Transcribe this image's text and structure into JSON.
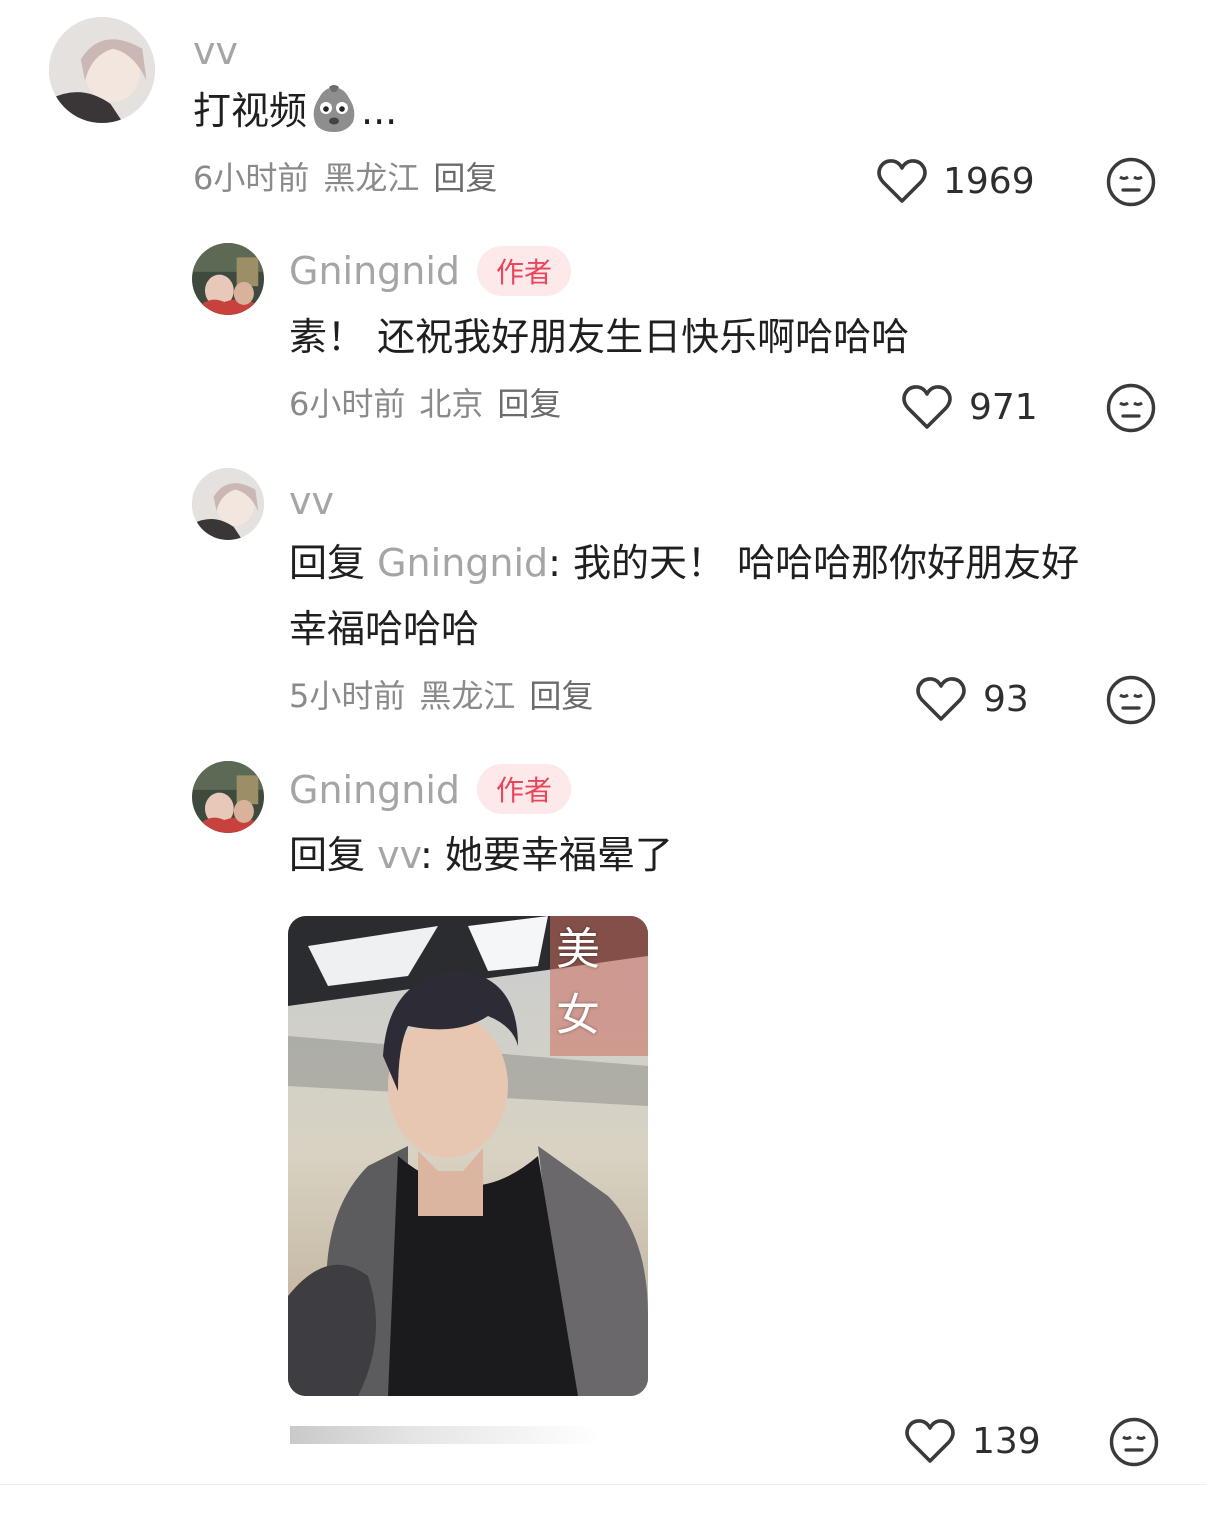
{
  "comment": {
    "author": "vv",
    "text": "打视频",
    "text_suffix": "...",
    "emoji_icon": "sad-face-emoji-icon",
    "time": "6小时前",
    "location": "黑龙江",
    "reply_label": "回复",
    "likes": "1969"
  },
  "replies": [
    {
      "author": "Gningnid",
      "badge": "作者",
      "text": "素！ 还祝我好朋友生日快乐啊哈哈哈",
      "time": "6小时前",
      "location": "北京",
      "reply_label": "回复",
      "likes": "971"
    },
    {
      "author": "vv",
      "reply_prefix": "回复",
      "reply_to": "Gningnid",
      "text_line1": ": 我的天！ 哈哈哈那你好朋友好",
      "text_line2": "幸福哈哈哈",
      "time": "5小时前",
      "location": "黑龙江",
      "reply_label": "回复",
      "likes": "93"
    },
    {
      "author": "Gningnid",
      "badge": "作者",
      "reply_prefix": "回复",
      "reply_to": "vv",
      "text": ": 她要幸福晕了",
      "image_label_1": "美",
      "image_label_2": "女",
      "likes": "139"
    }
  ],
  "icons": {
    "like": "heart-outline-icon",
    "dislike": "neutral-face-icon"
  },
  "colors": {
    "author_badge_bg": "#fde9ea",
    "author_badge_text": "#e9465c",
    "name_gray": "#a5a5a5",
    "meta_gray": "#8a8a8a"
  }
}
